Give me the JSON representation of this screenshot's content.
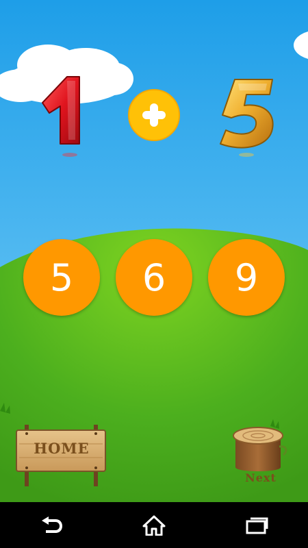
{
  "question": {
    "operand_left": "1",
    "operator": "+",
    "operand_right": "5"
  },
  "answers": [
    "5",
    "6",
    "9"
  ],
  "buttons": {
    "home_label": "Home",
    "next_label": "Next"
  },
  "colors": {
    "sky_top": "#1E9EE8",
    "sky_bottom": "#7ED0F8",
    "grass": "#4CAF1E",
    "answer_bg": "#FF9800",
    "plus_bg": "#FFC107",
    "digit_left": "#E0141E",
    "digit_right": "#E8A020",
    "navbar": "#000000"
  },
  "navbar": {
    "icons": [
      "back-icon",
      "home-icon",
      "recent-apps-icon"
    ]
  }
}
